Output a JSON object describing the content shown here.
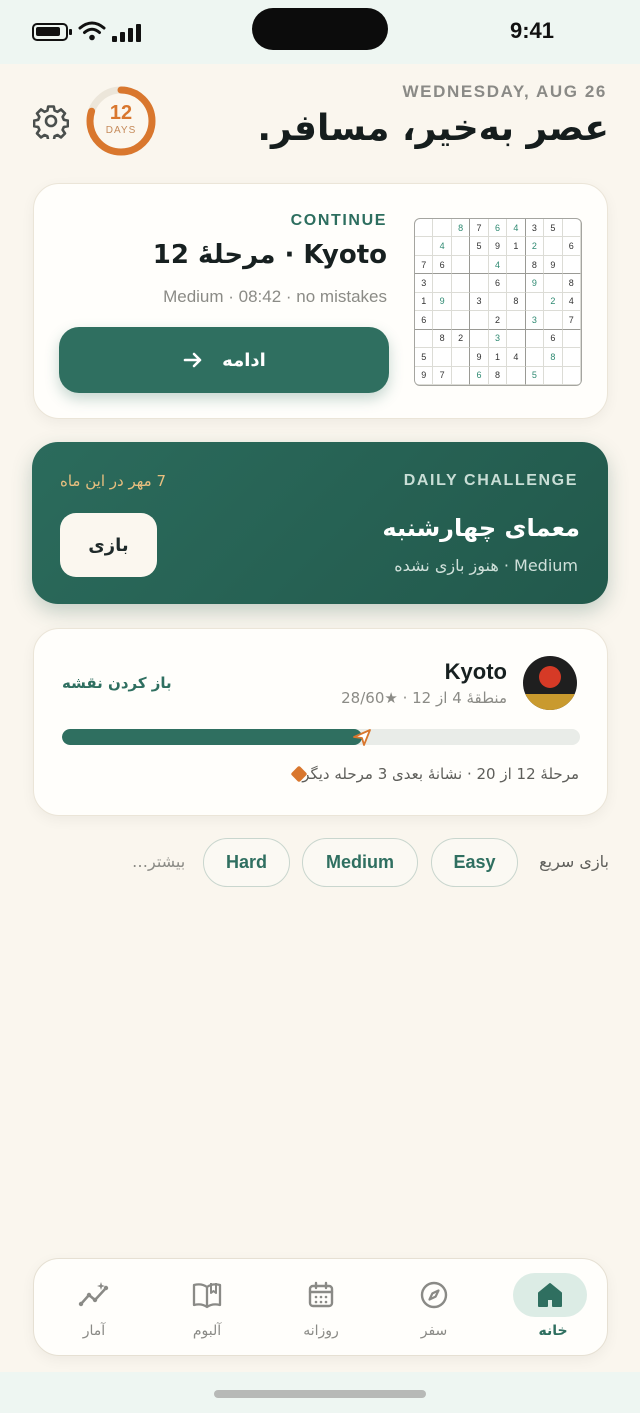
{
  "status": {
    "time": "9:41"
  },
  "header": {
    "date": "WEDNESDAY, AUG 26",
    "greeting": "عصر به‌خیر، مسافر.",
    "streak_days": "12",
    "streak_label": "DAYS",
    "streak_progress": 0.8
  },
  "continue_card": {
    "label": "CONTINUE",
    "title": "Kyoto · مرحلهٔ 12",
    "subtitle": "Medium · 08:42 · no mistakes",
    "button_label": "ادامه",
    "grid": [
      [
        "",
        "",
        "8",
        "7",
        "6",
        "4",
        "3",
        "5",
        ""
      ],
      [
        "",
        "4",
        "",
        "5",
        "9",
        "1",
        "2",
        "",
        "6"
      ],
      [
        "7",
        "6",
        "",
        "",
        "4",
        "",
        "8",
        "9",
        ""
      ],
      [
        "3",
        "",
        "",
        "",
        "6",
        "",
        "9",
        "",
        "8"
      ],
      [
        "1",
        "9",
        "",
        "3",
        "",
        "8",
        "",
        "2",
        "4"
      ],
      [
        "6",
        "",
        "",
        "",
        "2",
        "",
        "3",
        "",
        "7"
      ],
      [
        "",
        "8",
        "2",
        "",
        "3",
        "",
        "",
        "6",
        ""
      ],
      [
        "5",
        "",
        "",
        "9",
        "1",
        "4",
        "",
        "8",
        ""
      ],
      [
        "9",
        "7",
        "",
        "6",
        "8",
        "",
        "5",
        "",
        ""
      ]
    ],
    "grid_given": [
      [
        0,
        0,
        1,
        0,
        1,
        1,
        0,
        0,
        0
      ],
      [
        0,
        1,
        0,
        0,
        0,
        0,
        1,
        0,
        0
      ],
      [
        0,
        0,
        0,
        0,
        1,
        0,
        0,
        0,
        0
      ],
      [
        0,
        0,
        0,
        0,
        0,
        0,
        1,
        0,
        0
      ],
      [
        0,
        1,
        0,
        0,
        0,
        0,
        0,
        1,
        0
      ],
      [
        0,
        0,
        0,
        0,
        0,
        0,
        1,
        0,
        0
      ],
      [
        0,
        0,
        0,
        0,
        1,
        0,
        0,
        0,
        0
      ],
      [
        0,
        0,
        0,
        0,
        0,
        0,
        0,
        1,
        0
      ],
      [
        0,
        0,
        0,
        1,
        0,
        0,
        1,
        0,
        0
      ]
    ]
  },
  "daily_challenge": {
    "label": "DAILY CHALLENGE",
    "month_count": "7 مهر در این ماه",
    "title": "معمای چهارشنبه",
    "subtitle": "Medium · هنوز بازی نشده",
    "play_label": "بازی"
  },
  "journey": {
    "title": "Kyoto",
    "subtitle": "منطقهٔ 4 از 12 · ★28/60",
    "open_map": "باز کردن نقشه",
    "progress": 0.58,
    "next": "مرحلهٔ 12 از 20 · نشانهٔ بعدی 3 مرحله دیگر",
    "colors": {
      "sun": "#d63a26",
      "sky": "#1f1f1f",
      "ground": "#c99a2e"
    }
  },
  "quick_play": {
    "label": "بازی سریع",
    "chips": [
      "Easy",
      "Medium",
      "Hard"
    ],
    "more": "بیشتر…"
  },
  "tabs": [
    {
      "label": "خانه",
      "icon": "home-icon",
      "active": true
    },
    {
      "label": "سفر",
      "icon": "compass-icon",
      "active": false
    },
    {
      "label": "روزانه",
      "icon": "calendar-icon",
      "active": false
    },
    {
      "label": "آلبوم",
      "icon": "book-icon",
      "active": false
    },
    {
      "label": "آمار",
      "icon": "stats-icon",
      "active": false
    }
  ],
  "colors": {
    "accent": "#2f6f60",
    "streak": "#d9772e",
    "background": "#faf6ee"
  }
}
